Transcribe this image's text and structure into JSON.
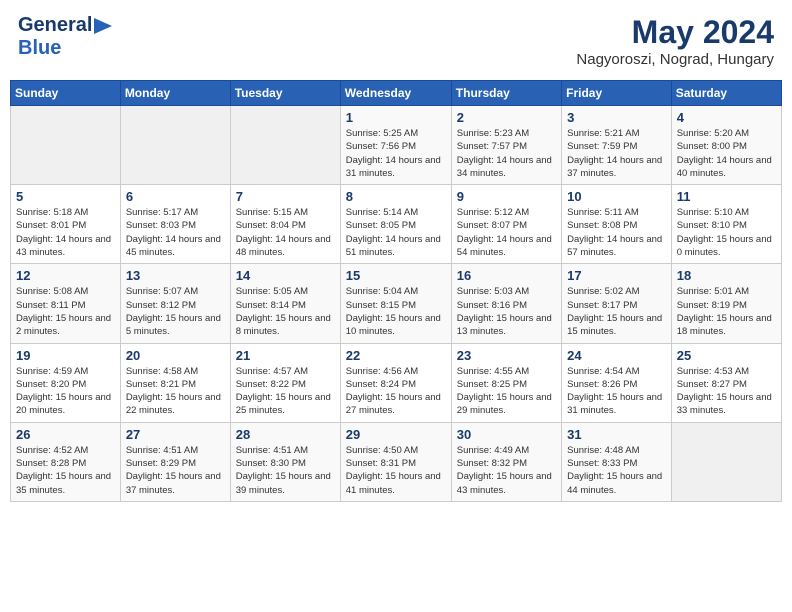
{
  "header": {
    "logo_line1": "General",
    "logo_line2": "Blue",
    "month": "May 2024",
    "location": "Nagyoroszi, Nograd, Hungary"
  },
  "weekdays": [
    "Sunday",
    "Monday",
    "Tuesday",
    "Wednesday",
    "Thursday",
    "Friday",
    "Saturday"
  ],
  "weeks": [
    [
      {
        "day": "",
        "sunrise": "",
        "sunset": "",
        "daylight": "",
        "empty": true
      },
      {
        "day": "",
        "sunrise": "",
        "sunset": "",
        "daylight": "",
        "empty": true
      },
      {
        "day": "",
        "sunrise": "",
        "sunset": "",
        "daylight": "",
        "empty": true
      },
      {
        "day": "1",
        "sunrise": "Sunrise: 5:25 AM",
        "sunset": "Sunset: 7:56 PM",
        "daylight": "Daylight: 14 hours and 31 minutes."
      },
      {
        "day": "2",
        "sunrise": "Sunrise: 5:23 AM",
        "sunset": "Sunset: 7:57 PM",
        "daylight": "Daylight: 14 hours and 34 minutes."
      },
      {
        "day": "3",
        "sunrise": "Sunrise: 5:21 AM",
        "sunset": "Sunset: 7:59 PM",
        "daylight": "Daylight: 14 hours and 37 minutes."
      },
      {
        "day": "4",
        "sunrise": "Sunrise: 5:20 AM",
        "sunset": "Sunset: 8:00 PM",
        "daylight": "Daylight: 14 hours and 40 minutes."
      }
    ],
    [
      {
        "day": "5",
        "sunrise": "Sunrise: 5:18 AM",
        "sunset": "Sunset: 8:01 PM",
        "daylight": "Daylight: 14 hours and 43 minutes."
      },
      {
        "day": "6",
        "sunrise": "Sunrise: 5:17 AM",
        "sunset": "Sunset: 8:03 PM",
        "daylight": "Daylight: 14 hours and 45 minutes."
      },
      {
        "day": "7",
        "sunrise": "Sunrise: 5:15 AM",
        "sunset": "Sunset: 8:04 PM",
        "daylight": "Daylight: 14 hours and 48 minutes."
      },
      {
        "day": "8",
        "sunrise": "Sunrise: 5:14 AM",
        "sunset": "Sunset: 8:05 PM",
        "daylight": "Daylight: 14 hours and 51 minutes."
      },
      {
        "day": "9",
        "sunrise": "Sunrise: 5:12 AM",
        "sunset": "Sunset: 8:07 PM",
        "daylight": "Daylight: 14 hours and 54 minutes."
      },
      {
        "day": "10",
        "sunrise": "Sunrise: 5:11 AM",
        "sunset": "Sunset: 8:08 PM",
        "daylight": "Daylight: 14 hours and 57 minutes."
      },
      {
        "day": "11",
        "sunrise": "Sunrise: 5:10 AM",
        "sunset": "Sunset: 8:10 PM",
        "daylight": "Daylight: 15 hours and 0 minutes."
      }
    ],
    [
      {
        "day": "12",
        "sunrise": "Sunrise: 5:08 AM",
        "sunset": "Sunset: 8:11 PM",
        "daylight": "Daylight: 15 hours and 2 minutes."
      },
      {
        "day": "13",
        "sunrise": "Sunrise: 5:07 AM",
        "sunset": "Sunset: 8:12 PM",
        "daylight": "Daylight: 15 hours and 5 minutes."
      },
      {
        "day": "14",
        "sunrise": "Sunrise: 5:05 AM",
        "sunset": "Sunset: 8:14 PM",
        "daylight": "Daylight: 15 hours and 8 minutes."
      },
      {
        "day": "15",
        "sunrise": "Sunrise: 5:04 AM",
        "sunset": "Sunset: 8:15 PM",
        "daylight": "Daylight: 15 hours and 10 minutes."
      },
      {
        "day": "16",
        "sunrise": "Sunrise: 5:03 AM",
        "sunset": "Sunset: 8:16 PM",
        "daylight": "Daylight: 15 hours and 13 minutes."
      },
      {
        "day": "17",
        "sunrise": "Sunrise: 5:02 AM",
        "sunset": "Sunset: 8:17 PM",
        "daylight": "Daylight: 15 hours and 15 minutes."
      },
      {
        "day": "18",
        "sunrise": "Sunrise: 5:01 AM",
        "sunset": "Sunset: 8:19 PM",
        "daylight": "Daylight: 15 hours and 18 minutes."
      }
    ],
    [
      {
        "day": "19",
        "sunrise": "Sunrise: 4:59 AM",
        "sunset": "Sunset: 8:20 PM",
        "daylight": "Daylight: 15 hours and 20 minutes."
      },
      {
        "day": "20",
        "sunrise": "Sunrise: 4:58 AM",
        "sunset": "Sunset: 8:21 PM",
        "daylight": "Daylight: 15 hours and 22 minutes."
      },
      {
        "day": "21",
        "sunrise": "Sunrise: 4:57 AM",
        "sunset": "Sunset: 8:22 PM",
        "daylight": "Daylight: 15 hours and 25 minutes."
      },
      {
        "day": "22",
        "sunrise": "Sunrise: 4:56 AM",
        "sunset": "Sunset: 8:24 PM",
        "daylight": "Daylight: 15 hours and 27 minutes."
      },
      {
        "day": "23",
        "sunrise": "Sunrise: 4:55 AM",
        "sunset": "Sunset: 8:25 PM",
        "daylight": "Daylight: 15 hours and 29 minutes."
      },
      {
        "day": "24",
        "sunrise": "Sunrise: 4:54 AM",
        "sunset": "Sunset: 8:26 PM",
        "daylight": "Daylight: 15 hours and 31 minutes."
      },
      {
        "day": "25",
        "sunrise": "Sunrise: 4:53 AM",
        "sunset": "Sunset: 8:27 PM",
        "daylight": "Daylight: 15 hours and 33 minutes."
      }
    ],
    [
      {
        "day": "26",
        "sunrise": "Sunrise: 4:52 AM",
        "sunset": "Sunset: 8:28 PM",
        "daylight": "Daylight: 15 hours and 35 minutes."
      },
      {
        "day": "27",
        "sunrise": "Sunrise: 4:51 AM",
        "sunset": "Sunset: 8:29 PM",
        "daylight": "Daylight: 15 hours and 37 minutes."
      },
      {
        "day": "28",
        "sunrise": "Sunrise: 4:51 AM",
        "sunset": "Sunset: 8:30 PM",
        "daylight": "Daylight: 15 hours and 39 minutes."
      },
      {
        "day": "29",
        "sunrise": "Sunrise: 4:50 AM",
        "sunset": "Sunset: 8:31 PM",
        "daylight": "Daylight: 15 hours and 41 minutes."
      },
      {
        "day": "30",
        "sunrise": "Sunrise: 4:49 AM",
        "sunset": "Sunset: 8:32 PM",
        "daylight": "Daylight: 15 hours and 43 minutes."
      },
      {
        "day": "31",
        "sunrise": "Sunrise: 4:48 AM",
        "sunset": "Sunset: 8:33 PM",
        "daylight": "Daylight: 15 hours and 44 minutes."
      },
      {
        "day": "",
        "sunrise": "",
        "sunset": "",
        "daylight": "",
        "empty": true
      }
    ]
  ]
}
